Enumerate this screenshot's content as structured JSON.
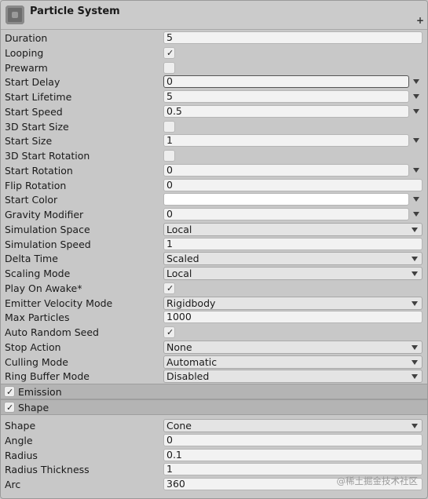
{
  "header": {
    "title": "Particle System",
    "add_glyph": "+"
  },
  "main_module": {
    "duration": {
      "label": "Duration",
      "value": "5"
    },
    "looping": {
      "label": "Looping",
      "checked": true
    },
    "prewarm": {
      "label": "Prewarm",
      "checked": false
    },
    "start_delay": {
      "label": "Start Delay",
      "value": "0"
    },
    "start_lifetime": {
      "label": "Start Lifetime",
      "value": "5"
    },
    "start_speed": {
      "label": "Start Speed",
      "value": "0.5"
    },
    "start_size_3d": {
      "label": "3D Start Size",
      "checked": false
    },
    "start_size": {
      "label": "Start Size",
      "value": "1"
    },
    "start_rotation_3d": {
      "label": "3D Start Rotation",
      "checked": false
    },
    "start_rotation": {
      "label": "Start Rotation",
      "value": "0"
    },
    "flip_rotation": {
      "label": "Flip Rotation",
      "value": "0"
    },
    "start_color": {
      "label": "Start Color",
      "color": "#ffffff"
    },
    "gravity_modifier": {
      "label": "Gravity Modifier",
      "value": "0"
    },
    "simulation_space": {
      "label": "Simulation Space",
      "value": "Local"
    },
    "simulation_speed": {
      "label": "Simulation Speed",
      "value": "1"
    },
    "delta_time": {
      "label": "Delta Time",
      "value": "Scaled"
    },
    "scaling_mode": {
      "label": "Scaling Mode",
      "value": "Local"
    },
    "play_on_awake": {
      "label": "Play On Awake*",
      "checked": true
    },
    "emitter_velocity_mode": {
      "label": "Emitter Velocity Mode",
      "value": "Rigidbody"
    },
    "max_particles": {
      "label": "Max Particles",
      "value": "1000"
    },
    "auto_random_seed": {
      "label": "Auto Random Seed",
      "checked": true
    },
    "stop_action": {
      "label": "Stop Action",
      "value": "None"
    },
    "culling_mode": {
      "label": "Culling Mode",
      "value": "Automatic"
    },
    "ring_buffer_mode": {
      "label": "Ring Buffer Mode",
      "value": "Disabled"
    }
  },
  "modules": {
    "emission": {
      "label": "Emission",
      "enabled": true
    },
    "shape": {
      "label": "Shape",
      "enabled": true
    }
  },
  "shape_module": {
    "shape": {
      "label": "Shape",
      "value": "Cone"
    },
    "angle": {
      "label": "Angle",
      "value": "0"
    },
    "radius": {
      "label": "Radius",
      "value": "0.1"
    },
    "radius_thickness": {
      "label": "Radius Thickness",
      "value": "1"
    },
    "arc": {
      "label": "Arc",
      "value": "360"
    }
  },
  "check_glyph": "✓",
  "watermark": "@稀土掘金技术社区",
  "colors": {
    "panel_bg": "#c8c8c8",
    "section_bg": "#b4b4b4",
    "field_bg": "#f2f2f2"
  }
}
